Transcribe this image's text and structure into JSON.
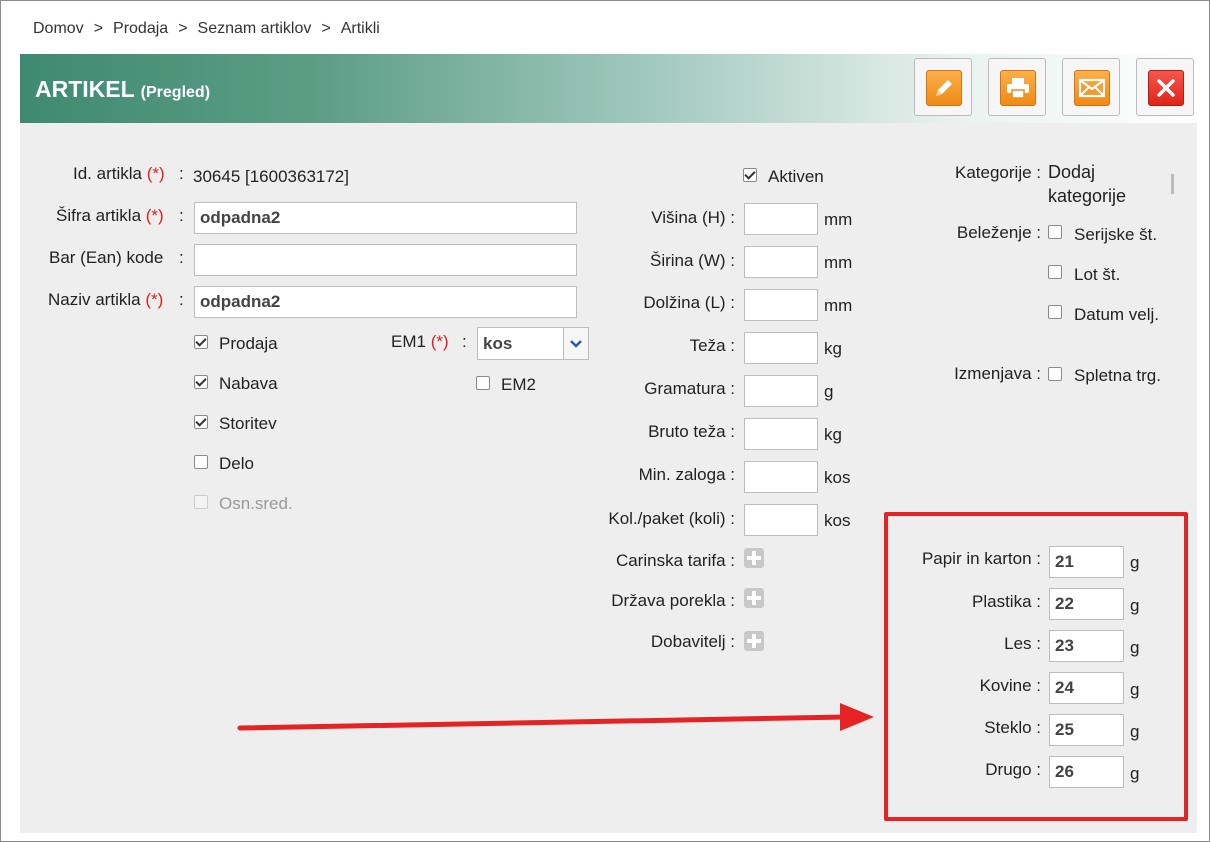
{
  "breadcrumb": [
    "Domov",
    "Prodaja",
    "Seznam artiklov",
    "Artikli"
  ],
  "breadcrumb_sep": ">",
  "header": {
    "title": "ARTIKEL",
    "subtitle": "(Pregled)"
  },
  "toolbar": [
    "pencil-icon",
    "printer-icon",
    "envelope-icon",
    "close-icon"
  ],
  "req": "(*)",
  "colon": ":",
  "form": {
    "id_label": "Id. artikla",
    "id_value": "30645 [1600363172]",
    "sifra_label": "Šifra artikla",
    "sifra_value": "odpadna2",
    "barcode_label": "Bar (Ean) kode",
    "barcode_value": "",
    "naziv_label": "Naziv artikla",
    "naziv_value": "odpadna2",
    "em1_label": "EM1",
    "em1_value": "kos",
    "em2_label": "EM2",
    "checks": [
      {
        "label": "Prodaja",
        "checked": true
      },
      {
        "label": "Nabava",
        "checked": true
      },
      {
        "label": "Storitev",
        "checked": true
      },
      {
        "label": "Delo",
        "checked": false
      },
      {
        "label": "Osn.sred.",
        "checked": false,
        "disabled": true
      }
    ]
  },
  "dims": {
    "aktiven": "Aktiven",
    "rows": [
      {
        "label": "Višina (H) :",
        "unit": "mm",
        "value": ""
      },
      {
        "label": "Širina (W) :",
        "unit": "mm",
        "value": ""
      },
      {
        "label": "Dolžina (L) :",
        "unit": "mm",
        "value": ""
      },
      {
        "label": "Teža :",
        "unit": "kg",
        "value": ""
      },
      {
        "label": "Gramatura :",
        "unit": "g",
        "value": ""
      },
      {
        "label": "Bruto teža :",
        "unit": "kg",
        "value": ""
      },
      {
        "label": "Min. zaloga :",
        "unit": "kos",
        "value": ""
      },
      {
        "label": "Kol./paket (koli) :",
        "unit": "kos",
        "value": ""
      }
    ],
    "plus_rows": [
      "Carinska tarifa :",
      "Država porekla :",
      "Dobavitelj :"
    ]
  },
  "side": {
    "kategorije_label": "Kategorije :",
    "kategorije_value": [
      "Dodaj",
      "kategorije"
    ],
    "belezenje_label": "Beleženje :",
    "belezenje_opts": [
      "Serijske št.",
      "Lot št.",
      "Datum velj."
    ],
    "izmenjava_label": "Izmenjava :",
    "izmenjava_opt": "Spletna trg."
  },
  "packaging": {
    "unit": "g",
    "rows": [
      {
        "label": "Papir in karton :",
        "value": "21"
      },
      {
        "label": "Plastika :",
        "value": "22"
      },
      {
        "label": "Les :",
        "value": "23"
      },
      {
        "label": "Kovine :",
        "value": "24"
      },
      {
        "label": "Steklo :",
        "value": "25"
      },
      {
        "label": "Drugo :",
        "value": "26"
      }
    ]
  },
  "colors": {
    "highlight": "#e52325",
    "header": "#3e8a70"
  }
}
